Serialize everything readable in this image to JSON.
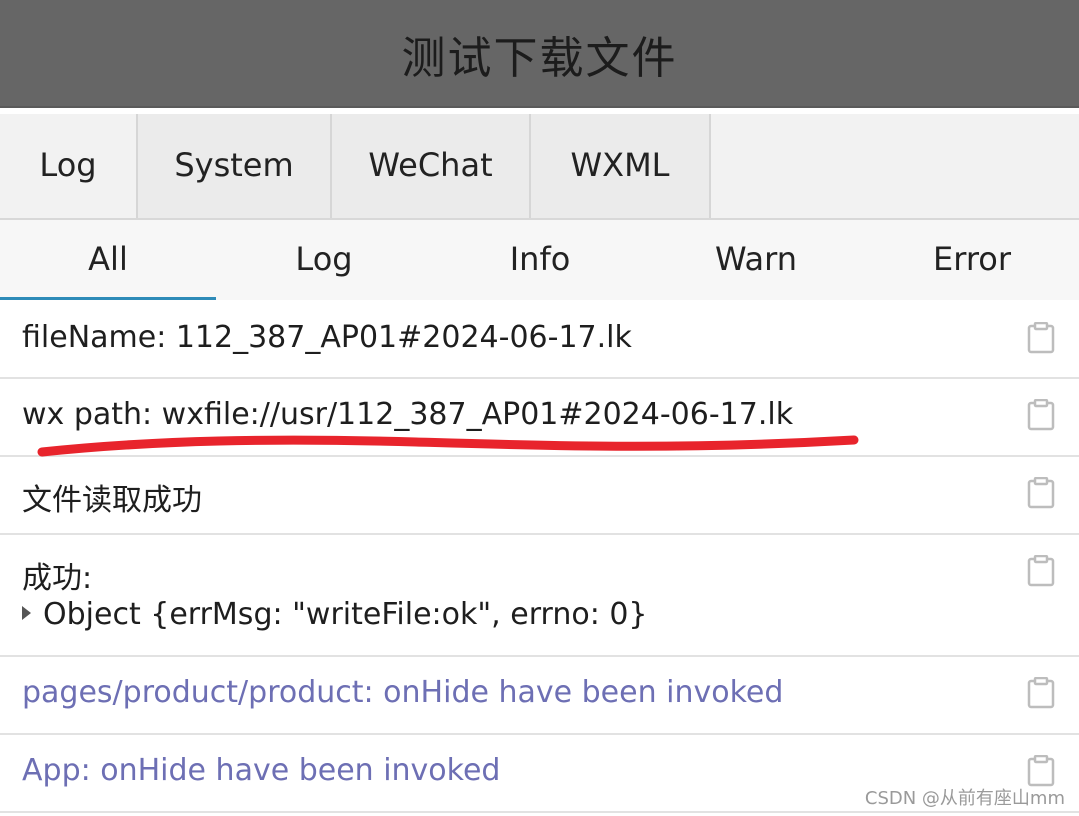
{
  "header": {
    "title": "测试下载文件"
  },
  "tabs_primary": [
    {
      "label": "Log"
    },
    {
      "label": "System"
    },
    {
      "label": "WeChat"
    },
    {
      "label": "WXML"
    }
  ],
  "tabs_filter": [
    {
      "label": "All"
    },
    {
      "label": "Log"
    },
    {
      "label": "Info"
    },
    {
      "label": "Warn"
    },
    {
      "label": "Error"
    }
  ],
  "logs": [
    {
      "text": "fileName:  112_387_AP01#2024-06-17.lk"
    },
    {
      "text": "wx path:  wxfile://usr/112_387_AP01#2024-06-17.lk"
    },
    {
      "text": "文件读取成功"
    },
    {
      "text": "成功:",
      "object": "Object {errMsg: \"writeFile:ok\", errno: 0}"
    },
    {
      "text": "pages/product/product: onHide have been invoked"
    },
    {
      "text": "App: onHide have been invoked"
    }
  ],
  "icons": {
    "copy": "copy-icon",
    "expand": "expand-arrow-icon"
  },
  "colors": {
    "header_bg": "#666666",
    "info_text": "#6d6fb4",
    "active_tab_underline": "#2e8bb8",
    "annotation_red": "#e8242c"
  },
  "watermark": "CSDN @从前有座山mm"
}
